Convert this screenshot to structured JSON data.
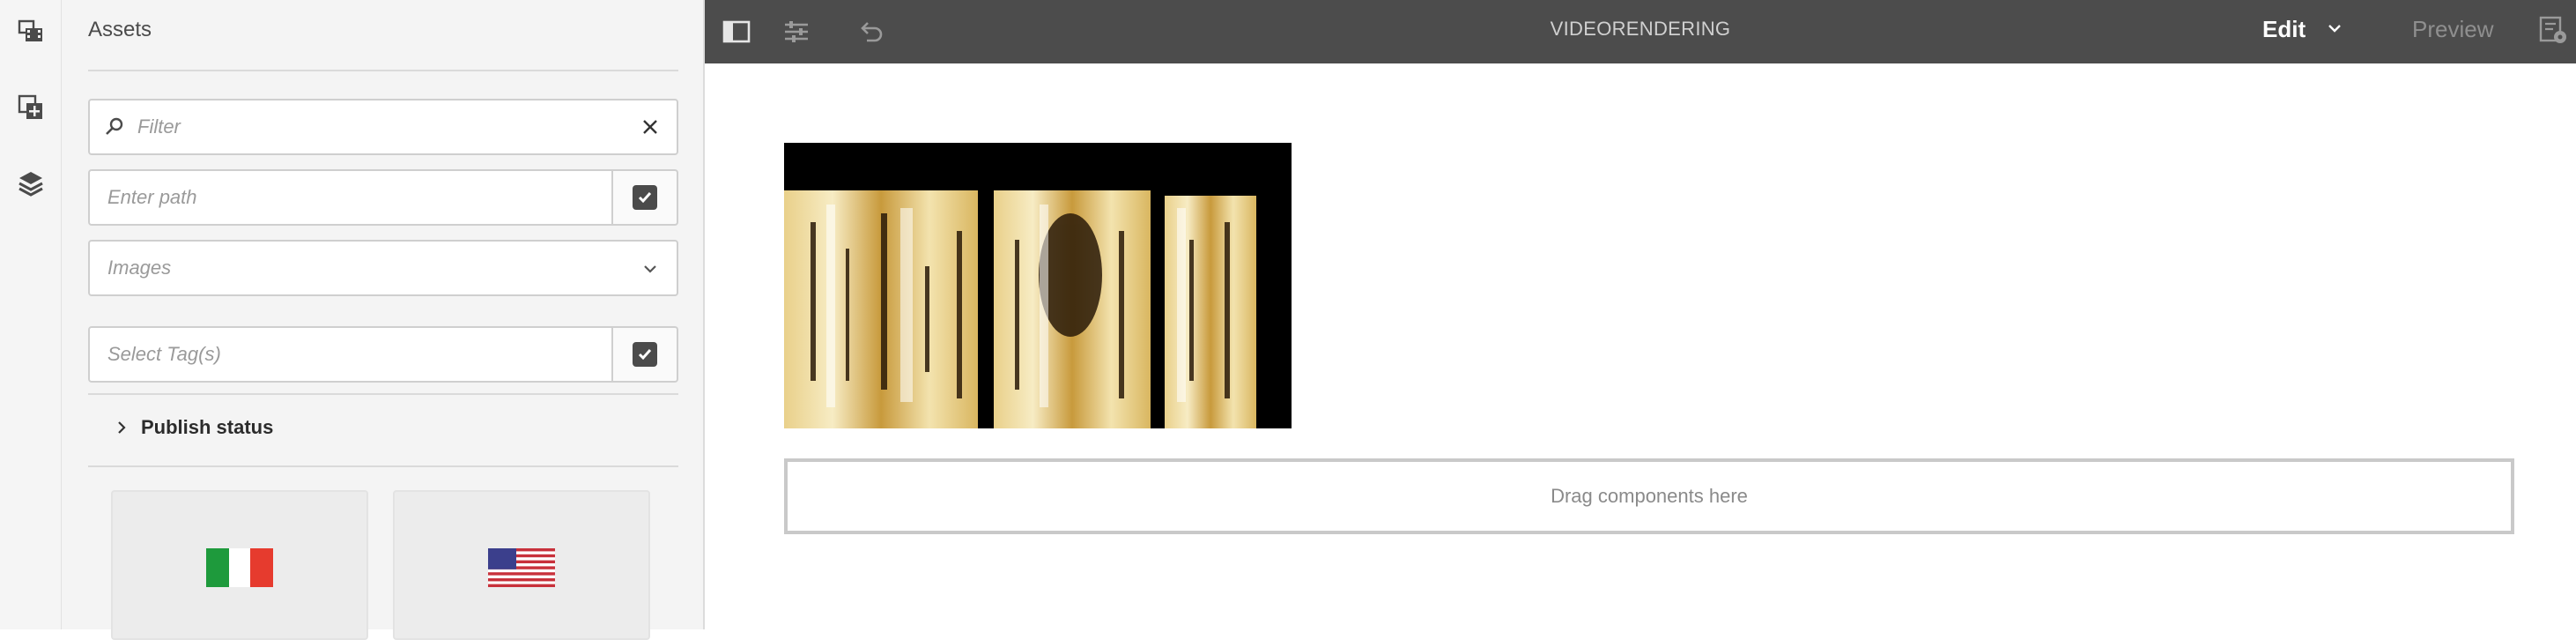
{
  "rail": {
    "items": [
      {
        "icon": "assets-browser-icon"
      },
      {
        "icon": "components-icon"
      },
      {
        "icon": "content-tree-icon"
      }
    ]
  },
  "panel": {
    "title": "Assets",
    "filter_placeholder": "Filter",
    "path_placeholder": "Enter path",
    "asset_type": "Images",
    "tags_placeholder": "Select Tag(s)",
    "publish_status_label": "Publish status",
    "cards": [
      {
        "name": "italy-flag"
      },
      {
        "name": "us-flag"
      }
    ]
  },
  "toolbar": {
    "page_title": "VIDEORENDERING",
    "mode": "Edit",
    "preview_label": "Preview"
  },
  "canvas": {
    "drop_zone_label": "Drag components here"
  },
  "colors": {
    "toolbar_bg": "#4c4c4c",
    "panel_bg": "#f4f4f4",
    "flag_green": "#1e9a3c",
    "flag_red": "#e63b2e",
    "us_red": "#c8313b",
    "us_blue": "#3b3f8c"
  }
}
